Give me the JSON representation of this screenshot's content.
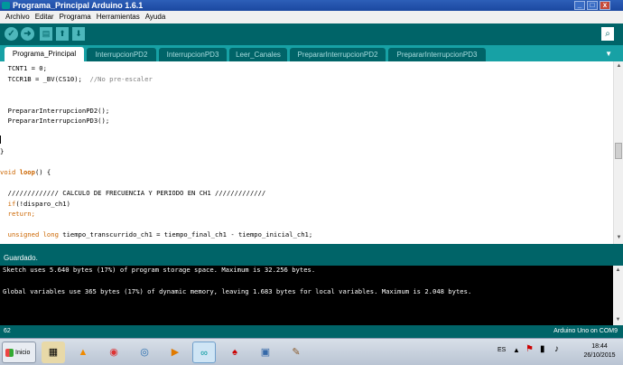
{
  "window": {
    "title": "Programa_Principal Arduino 1.6.1",
    "min": "_",
    "max": "□",
    "close": "x"
  },
  "menu": [
    "Archivo",
    "Editar",
    "Programa",
    "Herramientas",
    "Ayuda"
  ],
  "toolbar": {
    "verify": "✓",
    "upload": "➜",
    "new": "▤",
    "open": "⬆",
    "save": "⬇",
    "serial": "⌕"
  },
  "tabs": [
    "Programa_Principal",
    "InterrupcionPD2",
    "InterrupcionPD3",
    "Leer_Canales",
    "PrepararInterrupcionPD2",
    "PrepararInterrupcionPD3"
  ],
  "tab_menu": "▼",
  "code": {
    "l1": "  TCNT1 = 0;",
    "l2a": "  TCCR1B = _BV(CS10);  ",
    "l2b": "//No pre-escaler",
    "l3": "  PrepararInterrupcionPD2();",
    "l4": "  PrepararInterrupcionPD3();",
    "l5": "}",
    "l6a": "void",
    "l6b": " loop",
    "l6c": "() {",
    "l7": "  ///////////// CALCULO DE FRECUENCIA Y PERIODO EN CH1 /////////////",
    "l8a": "  if",
    "l8b": "(!disparo_ch1)",
    "l9": "  return;",
    "l10a": "  unsigned long",
    "l10b": " tiempo_transcurrido_ch1 = tiempo_final_ch1 - tiempo_inicial_ch1;"
  },
  "status": "Guardado.",
  "console": [
    "Sketch uses 5.640 bytes (17%) of program storage space. Maximum is 32.256 bytes.",
    "Global variables use 365 bytes (17%) of dynamic memory, leaving 1.683 bytes for local variables. Maximum is 2.048 bytes."
  ],
  "bottom": {
    "line": "62",
    "board": "Arduino Uno on COM9"
  },
  "taskbar": {
    "start": "Inicio",
    "lang": "ES",
    "time": "18:44",
    "date": "26/10/2015",
    "icons": [
      "explorer-icon",
      "vlc-icon",
      "chrome-icon",
      "network-icon",
      "media-player-icon",
      "arduino-icon",
      "acrobat-icon",
      "image-viewer-icon",
      "paint-icon"
    ]
  },
  "colors": {
    "teal_dark": "#006468",
    "teal": "#17a1a5",
    "keyword": "#cc6600",
    "comment": "#7e7e7e"
  }
}
